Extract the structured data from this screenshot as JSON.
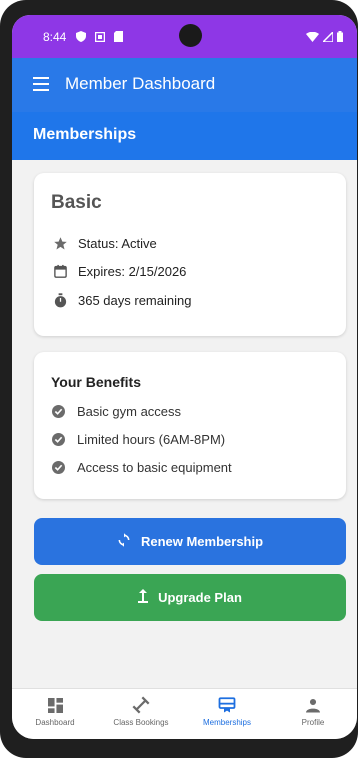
{
  "status_bar": {
    "time": "8:44"
  },
  "app_bar": {
    "title": "Member Dashboard"
  },
  "section": {
    "title": "Memberships"
  },
  "membership_card": {
    "plan_name": "Basic",
    "status": "Status: Active",
    "expires": "Expires: 2/15/2026",
    "remaining": "365 days remaining"
  },
  "benefits_card": {
    "title": "Your Benefits",
    "items": [
      "Basic gym access",
      "Limited hours (6AM-8PM)",
      "Access to basic equipment"
    ]
  },
  "actions": {
    "renew_label": "Renew Membership",
    "upgrade_label": "Upgrade Plan"
  },
  "bottom_nav": {
    "items": [
      {
        "label": "Dashboard",
        "icon": "dashboard-icon"
      },
      {
        "label": "Class Bookings",
        "icon": "dumbbell-icon"
      },
      {
        "label": "Memberships",
        "icon": "card-membership-icon",
        "active": true
      },
      {
        "label": "Profile",
        "icon": "person-icon"
      }
    ]
  },
  "colors": {
    "status_bar": "#8e37e6",
    "app_bar": "#2979e8",
    "section_header": "#1f76ea",
    "renew_button": "#2a73df",
    "upgrade_button": "#3aa554",
    "nav_active": "#1e6fe0"
  }
}
